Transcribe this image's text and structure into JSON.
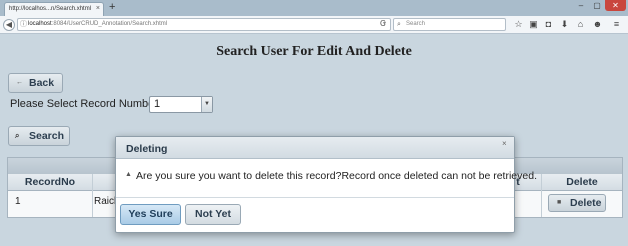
{
  "browser": {
    "tab_title": "http://localhos...n/Search.xhtml",
    "tab_close": "×",
    "new_tab": "+",
    "window_controls": {
      "minimize": "–",
      "maximize": "▢",
      "close": "✕"
    },
    "url_host": "localhost",
    "url_path": ":8084/UserCRUD_Annotation/Search.xhtml",
    "search_placeholder": "Search",
    "icons": [
      "star-icon",
      "clipboard-icon",
      "pocket-icon",
      "download-icon",
      "home-icon",
      "smiley-icon",
      "menu-icon"
    ]
  },
  "page": {
    "title": "Search User For Edit And Delete",
    "back_label": "Back",
    "record_label": "Please Select Record Number:",
    "record_value": "1",
    "search_label": "Search"
  },
  "grid": {
    "headers": {
      "record_no": "RecordNo",
      "name_partial": "",
      "t_partial": "t",
      "delete": "Delete"
    },
    "rows": [
      {
        "record_no": "1",
        "name_partial": "Raich",
        "delete_label": "Delete"
      }
    ]
  },
  "dialog": {
    "title": "Deleting",
    "close": "×",
    "message": "Are you sure you want to delete this record?Record once deleted can not be retrieved.",
    "yes_label": "Yes Sure",
    "no_label": "Not Yet"
  }
}
